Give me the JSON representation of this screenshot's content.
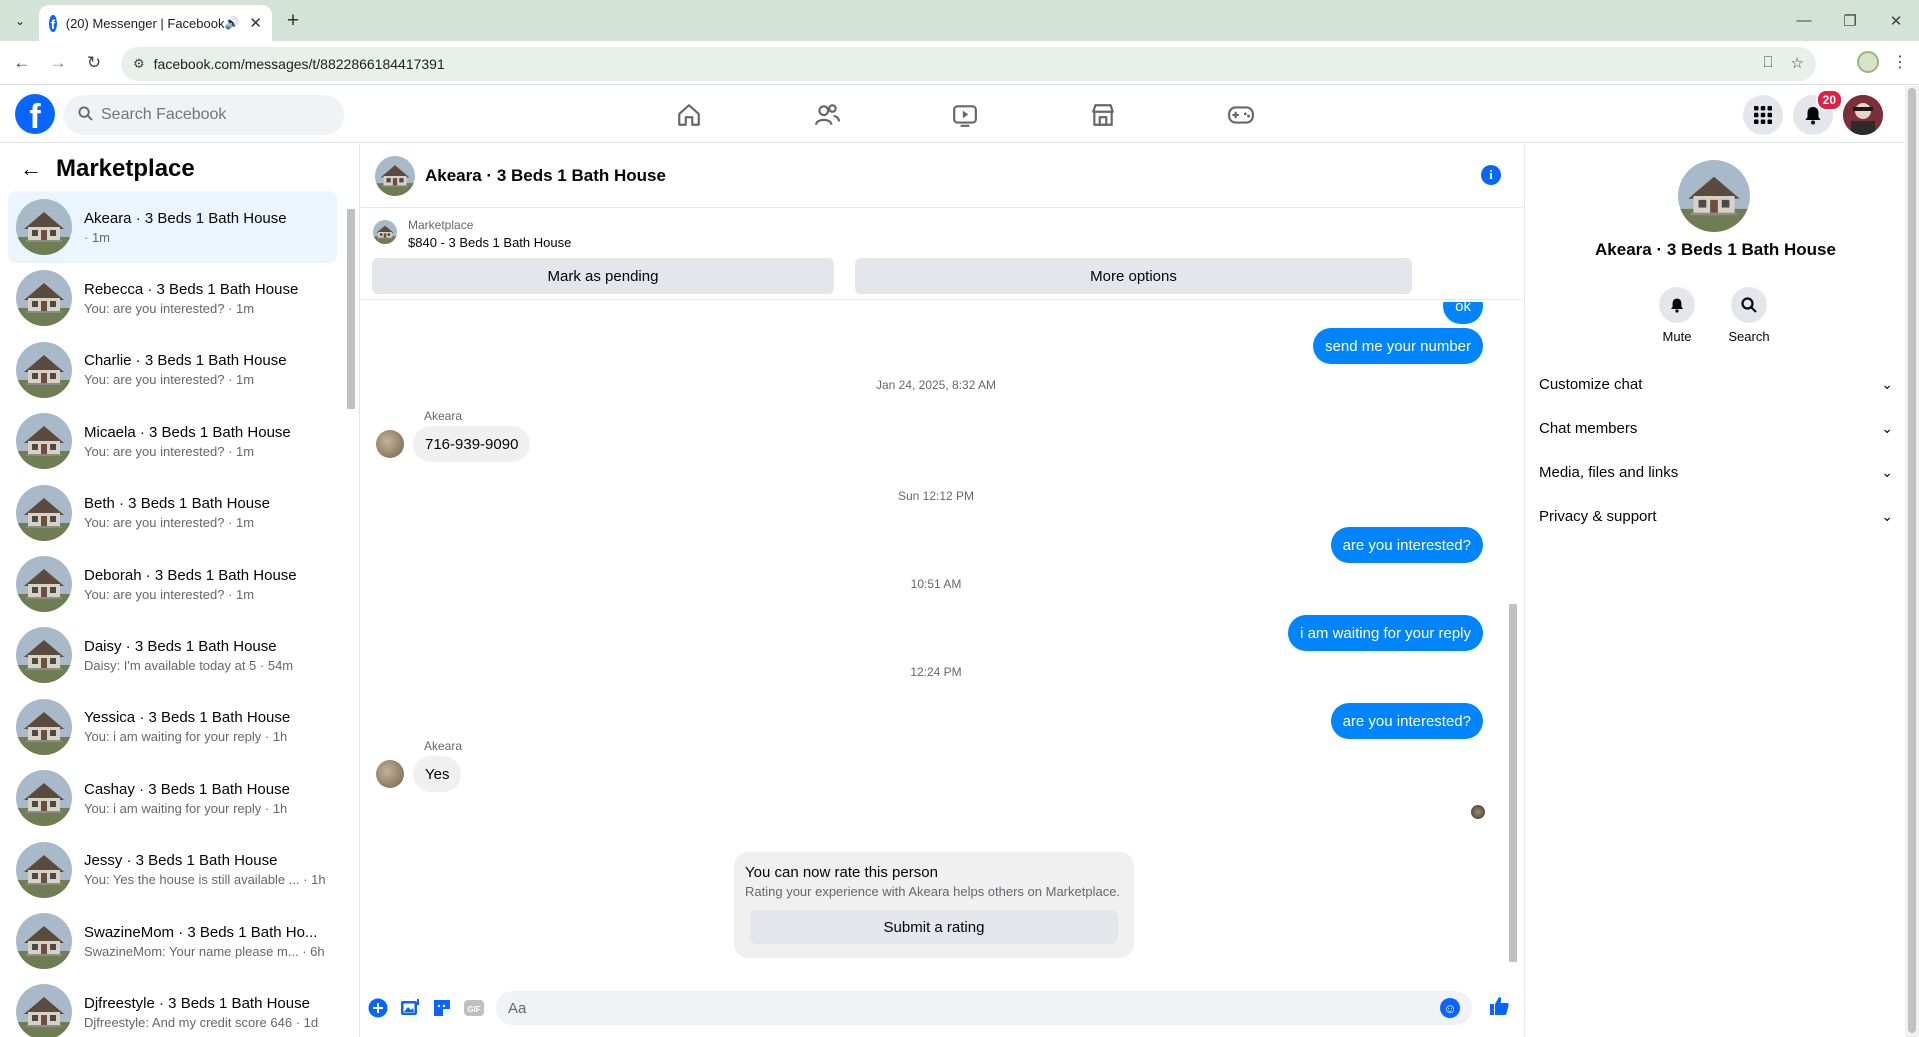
{
  "browser": {
    "tab_title": "(20) Messenger | Facebook",
    "url": "facebook.com/messages/t/8822866184417391"
  },
  "fb": {
    "search_placeholder": "Search Facebook",
    "notification_count": "20"
  },
  "left": {
    "title": "Marketplace",
    "conversations": [
      {
        "name": "Akeara · 3 Beds 1 Bath House",
        "snippet": "· 1m"
      },
      {
        "name": "Rebecca · 3 Beds 1 Bath House",
        "snippet": "You: are you interested? · 1m"
      },
      {
        "name": "Charlie · 3 Beds 1 Bath House",
        "snippet": "You: are you interested? · 1m"
      },
      {
        "name": "Micaela · 3 Beds 1 Bath House",
        "snippet": "You: are you interested? · 1m"
      },
      {
        "name": "Beth · 3 Beds 1 Bath House",
        "snippet": "You: are you interested? · 1m"
      },
      {
        "name": "Deborah · 3 Beds 1 Bath House",
        "snippet": "You: are you interested? · 1m"
      },
      {
        "name": "Daisy · 3 Beds 1 Bath House",
        "snippet": "Daisy: I'm available today at 5 · 54m"
      },
      {
        "name": "Yessica · 3 Beds 1 Bath House",
        "snippet": "You: i am waiting for your reply · 1h"
      },
      {
        "name": "Cashay · 3 Beds 1 Bath House",
        "snippet": "You: i am waiting for your reply · 1h"
      },
      {
        "name": "Jessy · 3 Beds 1 Bath House",
        "snippet": "You: Yes the house is still available ... · 1h"
      },
      {
        "name": "SwazineMom · 3 Beds 1 Bath Ho...",
        "snippet": "SwazineMom: Your name please m... · 6h"
      },
      {
        "name": "Djfreestyle · 3 Beds 1 Bath House",
        "snippet": "Djfreestyle: And my credit score 646 · 1d"
      }
    ]
  },
  "chat": {
    "title": "Akeara · 3 Beds 1 Bath House",
    "listing_kicker": "Marketplace",
    "listing_title": "$840 - 3 Beds 1 Bath House",
    "mark_pending": "Mark as pending",
    "more_options": "More options",
    "messages": {
      "out_ok": "ok",
      "out_number": "send me your number",
      "ts1": "Jan 24, 2025, 8:32 AM",
      "sender1": "Akeara",
      "in_phone": "716-939-9090",
      "ts2": "Sun 12:12 PM",
      "out_interested1": "are you interested?",
      "ts3": "10:51 AM",
      "out_waiting": "i am waiting for your reply",
      "ts4": "12:24 PM",
      "out_interested2": "are you interested?",
      "sender2": "Akeara",
      "in_yes": "Yes"
    },
    "rate": {
      "title": "You can now rate this person",
      "subtitle": "Rating your experience with Akeara helps others on Marketplace.",
      "button": "Submit a rating"
    },
    "composer_placeholder": "Aa"
  },
  "right": {
    "name": "Akeara · 3 Beds 1 Bath House",
    "mute": "Mute",
    "search": "Search",
    "rows": [
      "Customize chat",
      "Chat members",
      "Media, files and links",
      "Privacy & support"
    ]
  }
}
